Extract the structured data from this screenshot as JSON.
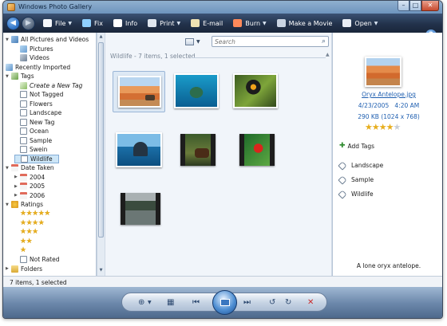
{
  "window": {
    "title": "Windows Photo Gallery",
    "controls": [
      "–",
      "□",
      "✕"
    ]
  },
  "menubar": {
    "items": [
      {
        "label": "File",
        "icon": "file-icon",
        "dropdown": true
      },
      {
        "label": "Fix",
        "icon": "fix-icon",
        "dropdown": false
      },
      {
        "label": "Info",
        "icon": "info-icon",
        "dropdown": false
      },
      {
        "label": "Print",
        "icon": "print-icon",
        "dropdown": true
      },
      {
        "label": "E-mail",
        "icon": "email-icon",
        "dropdown": false
      },
      {
        "label": "Burn",
        "icon": "burn-icon",
        "dropdown": true
      },
      {
        "label": "Make a Movie",
        "icon": "movie-icon",
        "dropdown": false
      },
      {
        "label": "Open",
        "icon": "open-icon",
        "dropdown": true
      }
    ],
    "help": "?"
  },
  "nav": {
    "tree": [
      {
        "label": "All Pictures and Videos",
        "level": 0,
        "icon": "gallery-icon",
        "expander": "▼"
      },
      {
        "label": "Pictures",
        "level": 1,
        "icon": "pictures-icon"
      },
      {
        "label": "Videos",
        "level": 1,
        "icon": "videos-icon"
      },
      {
        "label": "Recently Imported",
        "level": 0,
        "icon": "recent-icon"
      },
      {
        "label": "Tags",
        "level": 0,
        "icon": "tags-icon",
        "expander": "▼"
      },
      {
        "label": "Create a New Tag",
        "level": 1,
        "icon": "new-tag-icon",
        "italic": true
      },
      {
        "label": "Not Tagged",
        "level": 1,
        "icon": "tag-icon"
      },
      {
        "label": "Flowers",
        "level": 1,
        "icon": "tag-icon"
      },
      {
        "label": "Landscape",
        "level": 1,
        "icon": "tag-icon"
      },
      {
        "label": "New Tag",
        "level": 1,
        "icon": "tag-icon"
      },
      {
        "label": "Ocean",
        "level": 1,
        "icon": "tag-icon"
      },
      {
        "label": "Sample",
        "level": 1,
        "icon": "tag-icon"
      },
      {
        "label": "Swein",
        "level": 1,
        "icon": "tag-icon"
      },
      {
        "label": "Wildlife",
        "level": 1,
        "icon": "tag-icon",
        "selected": true
      },
      {
        "label": "Date Taken",
        "level": 0,
        "icon": "calendar-icon",
        "expander": "▼"
      },
      {
        "label": "2004",
        "level": 1,
        "icon": "calendar-icon",
        "expander": "▶"
      },
      {
        "label": "2005",
        "level": 1,
        "icon": "calendar-icon",
        "expander": "▶"
      },
      {
        "label": "2006",
        "level": 1,
        "icon": "calendar-icon",
        "expander": "▶"
      },
      {
        "label": "Ratings",
        "level": 0,
        "icon": "star-icon",
        "expander": "▼"
      },
      {
        "stars": "★★★★★",
        "level": 1,
        "rating": 5
      },
      {
        "stars": "★★★★",
        "level": 1,
        "rating": 4
      },
      {
        "stars": "★★★",
        "level": 1,
        "rating": 3
      },
      {
        "stars": "★★",
        "level": 1,
        "rating": 2
      },
      {
        "stars": "★",
        "level": 1,
        "rating": 1
      },
      {
        "label": "Not Rated",
        "level": 1,
        "icon": "empty-star-icon"
      },
      {
        "label": "Folders",
        "level": 0,
        "icon": "folder-icon",
        "expander": "▶"
      }
    ]
  },
  "content": {
    "search_placeholder": "Search",
    "group_header": "Wildlife - 7 items, 1 selected",
    "thumbnails": [
      {
        "name": "oryx-antelope",
        "type": "photo",
        "selected": true
      },
      {
        "name": "sea-turtle",
        "type": "photo"
      },
      {
        "name": "toucan",
        "type": "photo"
      },
      {
        "name": "whale-tail",
        "type": "photo"
      },
      {
        "name": "bear-video",
        "type": "video"
      },
      {
        "name": "parrot-video",
        "type": "video"
      },
      {
        "name": "river-video",
        "type": "video"
      }
    ]
  },
  "info": {
    "file_name": "Oryx Antelope.jpg",
    "date": "4/23/2005",
    "time": "4:20 AM",
    "size": "290 KB (1024 x 768)",
    "rating": 4,
    "rating_max": 5,
    "add_tags": "Add Tags",
    "tags": [
      "Landscape",
      "Sample",
      "Wildlife"
    ],
    "caption": "A lone oryx antelope."
  },
  "status": {
    "text": "7 items, 1 selected"
  },
  "colors": {
    "menubar": "#22324b",
    "accent": "#1f5fb0",
    "selection": "#cde6f7",
    "star": "#e7ae1e"
  }
}
